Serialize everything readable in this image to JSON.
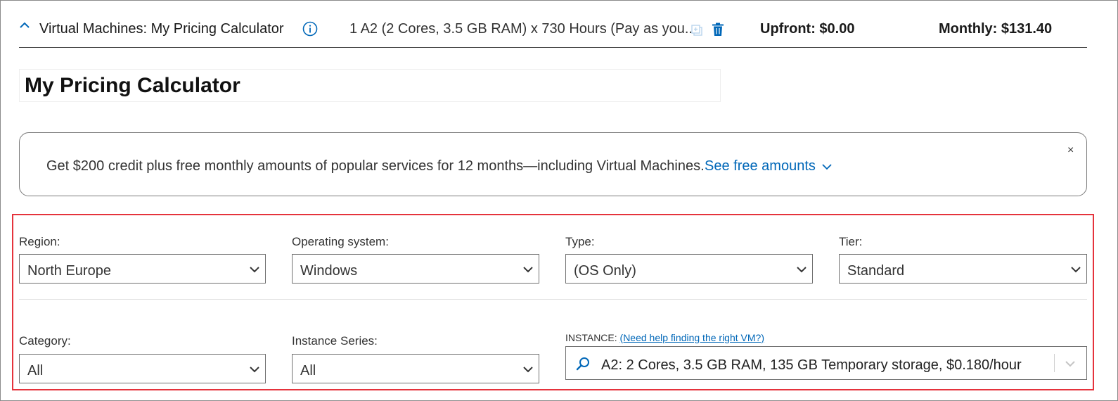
{
  "header": {
    "title": "Virtual Machines: My Pricing Calculator",
    "summary": "1 A2 (2 Cores, 3.5 GB RAM) x 730 Hours (Pay as you...",
    "upfront": "Upfront: $0.00",
    "monthly": "Monthly: $131.40"
  },
  "estimate_name": "My Pricing Calculator",
  "banner": {
    "text": "Get $200 credit plus free monthly amounts of popular services for 12 months—including Virtual Machines.",
    "link": "See free amounts",
    "close": "×"
  },
  "filters": {
    "region": {
      "label": "Region:",
      "value": "North Europe"
    },
    "os": {
      "label": "Operating system:",
      "value": "Windows"
    },
    "type": {
      "label": "Type:",
      "value": "(OS Only)"
    },
    "tier": {
      "label": "Tier:",
      "value": "Standard"
    },
    "category": {
      "label": "Category:",
      "value": "All"
    },
    "series": {
      "label": "Instance Series:",
      "value": "All"
    }
  },
  "instance": {
    "label": "INSTANCE:",
    "help_link": "(Need help finding the right VM?)",
    "value": "A2: 2 Cores, 3.5 GB RAM, 135 GB Temporary storage, $0.180/hour"
  },
  "colors": {
    "accent": "#0067b8",
    "highlight": "#e5333c"
  },
  "icons": [
    "chevron-up-icon",
    "info-icon",
    "copy-icon",
    "trash-icon",
    "chevron-down-icon",
    "close-icon",
    "search-icon"
  ]
}
